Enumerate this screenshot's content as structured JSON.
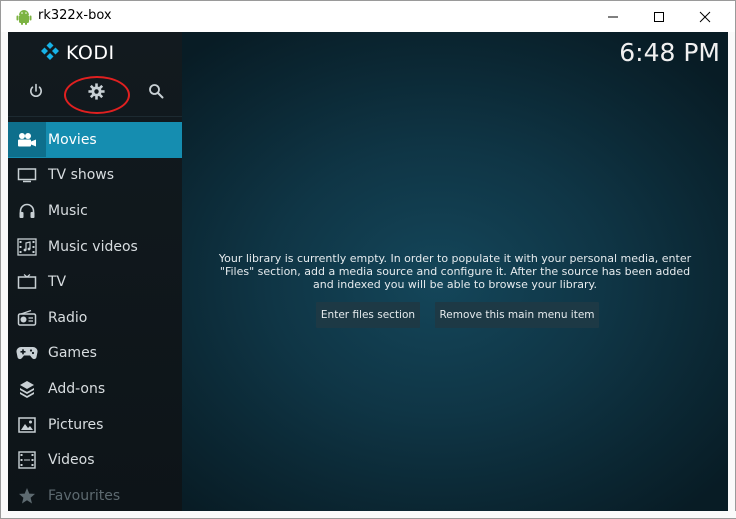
{
  "window": {
    "title": "rk322x-box",
    "icon": "android-icon",
    "controls": [
      "minimize-icon",
      "maximize-icon",
      "close-icon"
    ]
  },
  "kodi": {
    "logo_text": "KODI",
    "clock": "6:48 PM",
    "top_icons": [
      "power-icon",
      "gear-icon",
      "search-icon"
    ],
    "menu": [
      {
        "label": "Movies",
        "icon": "movies-icon",
        "active": true
      },
      {
        "label": "TV shows",
        "icon": "tv-shows-icon"
      },
      {
        "label": "Music",
        "icon": "headphones-icon"
      },
      {
        "label": "Music videos",
        "icon": "music-videos-icon"
      },
      {
        "label": "TV",
        "icon": "tv-icon"
      },
      {
        "label": "Radio",
        "icon": "radio-icon"
      },
      {
        "label": "Games",
        "icon": "gamepad-icon"
      },
      {
        "label": "Add-ons",
        "icon": "addons-icon"
      },
      {
        "label": "Pictures",
        "icon": "pictures-icon"
      },
      {
        "label": "Videos",
        "icon": "videos-icon"
      },
      {
        "label": "Favourites",
        "icon": "star-icon"
      }
    ],
    "message": {
      "line1": "Your library is currently empty. In order to populate it with your personal media, enter",
      "line2": "\"Files\" section, add a media source and configure it. After the source has been added",
      "line3": "and indexed you will be able to browse your library."
    },
    "buttons": {
      "enter_files": "Enter files section",
      "remove_item": "Remove this main menu item"
    }
  },
  "colors": {
    "accent": "#158db0",
    "sidebar": "#0f171b",
    "background": "#0f3545",
    "highlight_circle": "#e02020"
  }
}
